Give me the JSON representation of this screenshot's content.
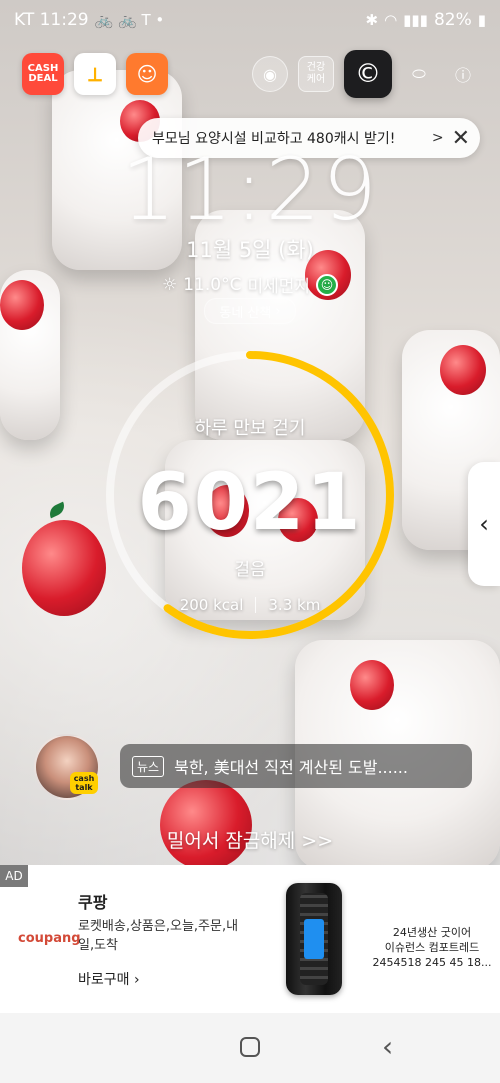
{
  "status_bar": {
    "carrier_time": "KT 11:29",
    "battery": "82%"
  },
  "app_shortcuts": {
    "cash_deal": "CASH\nDEAL",
    "health_label": "건강\n케어"
  },
  "banner": {
    "text": "부모님 요양시설 비교하고 480캐시 받기!",
    "arrow": ">",
    "close": "✕"
  },
  "lockscreen": {
    "time": "11:29",
    "date": "11월 5일 (화)",
    "temperature": "11.0°C",
    "dust_label": "미세먼지",
    "walk_pill": "동네 산책"
  },
  "steps": {
    "title": "하루 만보 걷기",
    "count": "6021",
    "unit": "걸음",
    "kcal": "200 kcal",
    "distance": "3.3 km",
    "progress_fraction": 0.6
  },
  "news": {
    "badge": "뉴스",
    "text": "북한, 美대선 직전 계산된 도발......"
  },
  "unlock": {
    "text": "밀어서 잠금해제 >>"
  },
  "ad": {
    "badge": "AD",
    "brand": "coupang",
    "title": "쿠팡",
    "description": "로켓배송,상품은,오늘,주문,내일,도착",
    "cta": "바로구매",
    "product_line1": "24년생산 굿이어",
    "product_line2": "이슈런스 컴포트레드",
    "product_line3": "2454518 245 45 18..."
  }
}
